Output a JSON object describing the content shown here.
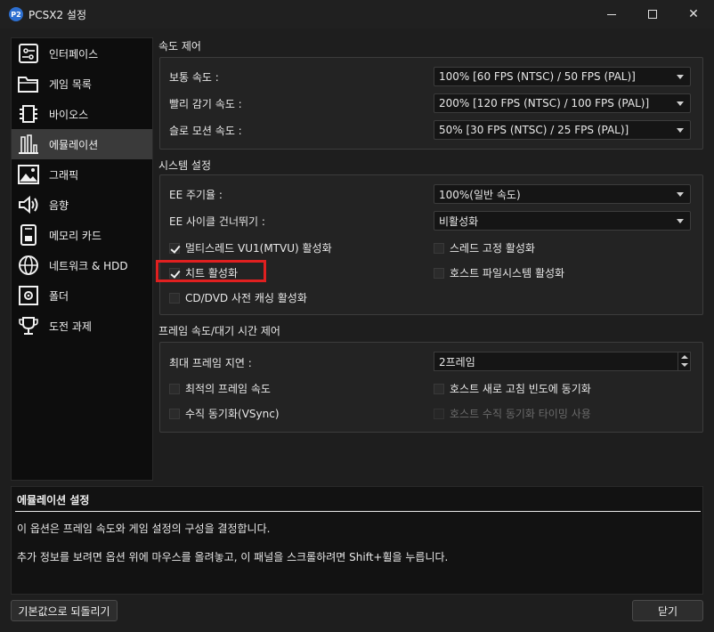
{
  "window": {
    "title": "PCSX2 설정",
    "app_icon": "pcsx2-icon"
  },
  "sidebar": {
    "items": [
      {
        "label": "인터페이스",
        "icon": "interface-settings-icon"
      },
      {
        "label": "게임 목록",
        "icon": "folder-icon"
      },
      {
        "label": "바이오스",
        "icon": "chip-icon"
      },
      {
        "label": "에뮬레이션",
        "icon": "emulation-icon"
      },
      {
        "label": "그래픽",
        "icon": "image-icon"
      },
      {
        "label": "음향",
        "icon": "speaker-icon"
      },
      {
        "label": "메모리 카드",
        "icon": "memory-card-icon"
      },
      {
        "label": "네트워크 & HDD",
        "icon": "globe-icon"
      },
      {
        "label": "폴더",
        "icon": "folder-settings-icon"
      },
      {
        "label": "도전 과제",
        "icon": "trophy-icon"
      }
    ],
    "active": "에뮬레이션"
  },
  "speed": {
    "title": "속도 제어",
    "normal_label": "보통 속도 :",
    "normal_value": "100% [60 FPS (NTSC) / 50 FPS (PAL)]",
    "fast_label": "빨리 감기 속도 :",
    "fast_value": "200% [120 FPS (NTSC) / 100 FPS (PAL)]",
    "slow_label": "슬로 모션 속도 :",
    "slow_value": "50% [30 FPS (NTSC) / 25 FPS (PAL)]"
  },
  "system": {
    "title": "시스템 설정",
    "ee_cycle_label": "EE 주기율 :",
    "ee_cycle_value": "100%(일반 속도)",
    "ee_skip_label": "EE 사이클 건너뛰기 :",
    "ee_skip_value": "비활성화",
    "mtvu": {
      "label": "멀티스레드 VU1(MTVU) 활성화",
      "checked": true
    },
    "thread_pin": {
      "label": "스레드 고정 활성화",
      "checked": false
    },
    "cheats": {
      "label": "치트 활성화",
      "checked": true
    },
    "host_fs": {
      "label": "호스트 파일시스템 활성화",
      "checked": false
    },
    "cdvd": {
      "label": "CD/DVD 사전 캐싱 활성화",
      "checked": false
    }
  },
  "frame": {
    "title": "프레임 속도/대기 시간 제어",
    "max_lag_label": "최대 프레임 지연 :",
    "max_lag_value": "2프레임",
    "optimal": {
      "label": "최적의 프레임 속도",
      "checked": false
    },
    "sync_refresh": {
      "label": "호스트 새로 고침 빈도에 동기화",
      "checked": false
    },
    "vsync": {
      "label": "수직 동기화(VSync)",
      "checked": false
    },
    "host_vsync_timing": {
      "label": "호스트 수직 동기화 타이밍 사용",
      "checked": false,
      "disabled": true
    }
  },
  "description": {
    "title": "에뮬레이션 설정",
    "line1": "이 옵션은 프레임 속도와 게임 설정의 구성을 결정합니다.",
    "line2": "추가 정보를 보려면 옵션 위에 마우스를 올려놓고, 이 패널을 스크롤하려면 Shift+휠을 누릅니다."
  },
  "buttons": {
    "reset": "기본값으로 되돌리기",
    "close": "닫기"
  },
  "colors": {
    "highlight": "#e02020",
    "active_item": "#3a3a3a"
  }
}
